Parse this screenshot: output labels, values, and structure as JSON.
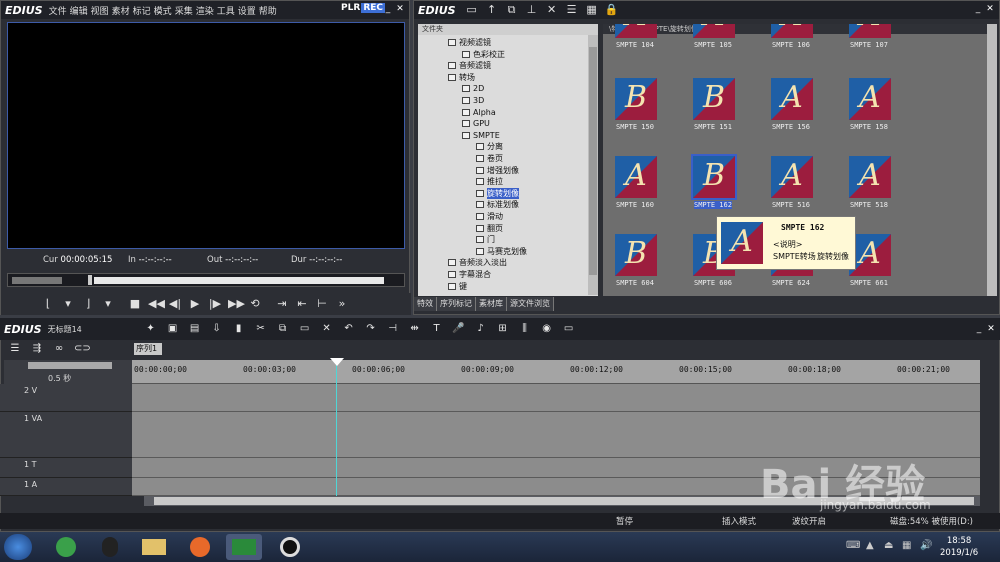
{
  "player": {
    "brand": "EDIUS",
    "menu": [
      "文件",
      "编辑",
      "视图",
      "素材",
      "标记",
      "模式",
      "采集",
      "渲染",
      "工具",
      "设置",
      "帮助"
    ],
    "mode_plr": "PLR",
    "mode_rec": "REC",
    "cur_label": "Cur",
    "cur_value": "00:00:05:15",
    "in_label": "In",
    "in_value": "--:--:--:--",
    "out_label": "Out",
    "out_value": "--:--:--:--",
    "dur_label": "Dur",
    "dur_value": "--:--:--:--"
  },
  "effects": {
    "brand": "EDIUS",
    "tree_header": "文件夹",
    "tree": [
      {
        "label": "视频滤镜",
        "indent": 0,
        "sel": false
      },
      {
        "label": "色彩校正",
        "indent": 1,
        "sel": false
      },
      {
        "label": "音频滤镜",
        "indent": 0,
        "sel": false
      },
      {
        "label": "转场",
        "indent": 0,
        "sel": false
      },
      {
        "label": "2D",
        "indent": 1,
        "sel": false
      },
      {
        "label": "3D",
        "indent": 1,
        "sel": false
      },
      {
        "label": "Alpha",
        "indent": 1,
        "sel": false
      },
      {
        "label": "GPU",
        "indent": 1,
        "sel": false
      },
      {
        "label": "SMPTE",
        "indent": 1,
        "sel": false
      },
      {
        "label": "分离",
        "indent": 2,
        "sel": false
      },
      {
        "label": "卷页",
        "indent": 2,
        "sel": false
      },
      {
        "label": "增强划像",
        "indent": 2,
        "sel": false
      },
      {
        "label": "推拉",
        "indent": 2,
        "sel": false
      },
      {
        "label": "旋转划像",
        "indent": 2,
        "sel": true
      },
      {
        "label": "标准划像",
        "indent": 2,
        "sel": false
      },
      {
        "label": "滑动",
        "indent": 2,
        "sel": false
      },
      {
        "label": "翻页",
        "indent": 2,
        "sel": false
      },
      {
        "label": "门",
        "indent": 2,
        "sel": false
      },
      {
        "label": "马赛克划像",
        "indent": 2,
        "sel": false
      },
      {
        "label": "音频淡入淡出",
        "indent": 0,
        "sel": false
      },
      {
        "label": "字幕混合",
        "indent": 0,
        "sel": false
      },
      {
        "label": "键",
        "indent": 0,
        "sel": false
      }
    ],
    "tabs": [
      "特效",
      "序列标记",
      "素材库",
      "源文件浏览"
    ],
    "path": "\\特效\\转场\\SMPTE\\旋转划像",
    "items": [
      {
        "label": "SMPTE  104",
        "glyph": "A"
      },
      {
        "label": "SMPTE  105",
        "glyph": "A"
      },
      {
        "label": "SMPTE  106",
        "glyph": "A"
      },
      {
        "label": "SMPTE  107",
        "glyph": "A"
      },
      {
        "label": "SMPTE  150",
        "glyph": "B"
      },
      {
        "label": "SMPTE  151",
        "glyph": "B"
      },
      {
        "label": "SMPTE  156",
        "glyph": "A"
      },
      {
        "label": "SMPTE  158",
        "glyph": "A"
      },
      {
        "label": "SMPTE  160",
        "glyph": "A"
      },
      {
        "label": "SMPTE  162",
        "glyph": "B"
      },
      {
        "label": "SMPTE  516",
        "glyph": "A"
      },
      {
        "label": "SMPTE  518",
        "glyph": "A"
      },
      {
        "label": "SMPTE  604",
        "glyph": "B"
      },
      {
        "label": "SMPTE  606",
        "glyph": "B"
      },
      {
        "label": "SMPTE  624",
        "glyph": "A"
      },
      {
        "label": "SMPTE  661",
        "glyph": "A"
      }
    ],
    "tooltip": {
      "title": "SMPTE  162",
      "desc": "<说明>",
      "kind": "SMPTE转场",
      "name": "旋转划像",
      "glyph": "A"
    }
  },
  "timeline": {
    "brand": "EDIUS",
    "project": "无标题14",
    "sequence_tab": "序列1",
    "zoom": "0.5 秒",
    "ruler": [
      "00:00:00;00",
      "00:00:03;00",
      "00:00:06;00",
      "00:00:09;00",
      "00:00:12;00",
      "00:00:15;00",
      "00:00:18;00",
      "00:00:21;00"
    ],
    "tracks": [
      {
        "name": "2 V"
      },
      {
        "name": "1 VA"
      },
      {
        "name": "1 T"
      },
      {
        "name": "1 A"
      }
    ],
    "status": {
      "pause": "暂停",
      "insert": "插入模式",
      "ripple": "波纹开启",
      "disk": "磁盘:54% 被使用(D:)"
    }
  },
  "taskbar": {
    "time": "18:58",
    "date": "2019/1/6"
  },
  "watermark": {
    "text": "Bai  经验",
    "url": "jingyan.baidu.com"
  },
  "colors": {
    "thumb_red": "#9c1d3e",
    "thumb_blue": "#1f5fa6",
    "accent": "#3a5fc8"
  }
}
